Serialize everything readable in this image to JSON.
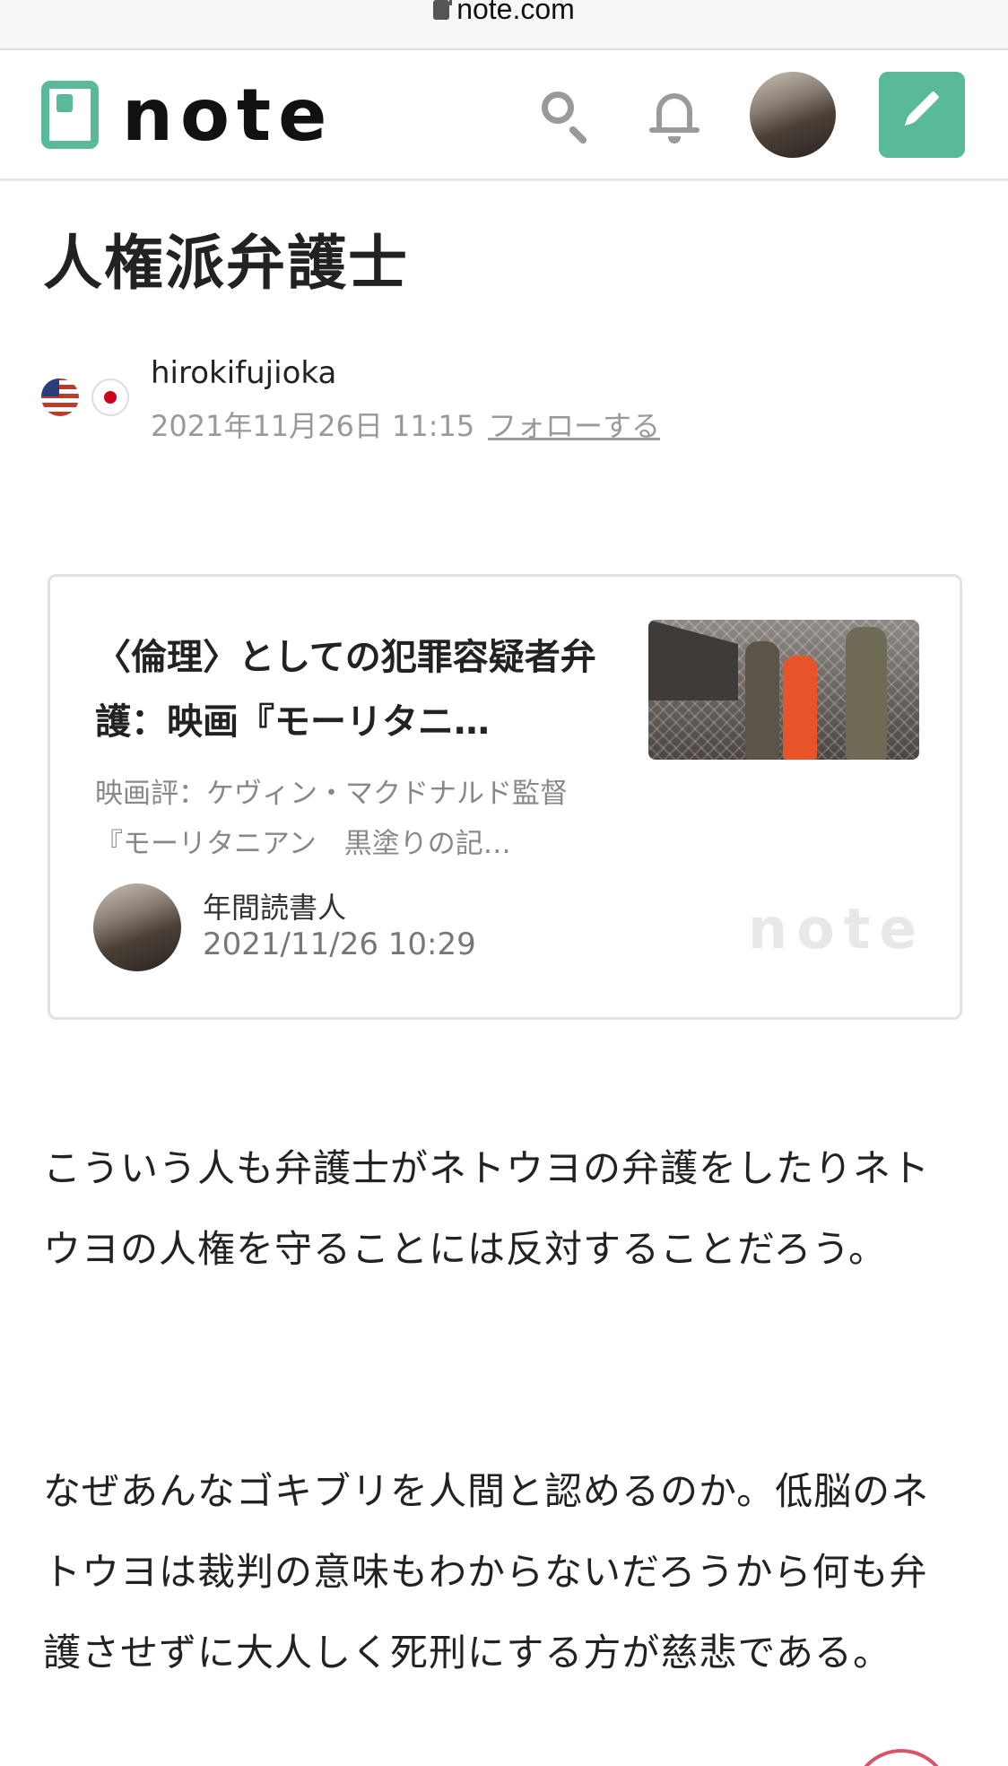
{
  "browser": {
    "url": "note.com"
  },
  "header": {
    "logo_text": "note",
    "search_icon": "search-icon",
    "notification_icon": "bell-icon",
    "post_icon": "pencil-icon",
    "accent_color": "#5ab89b"
  },
  "article": {
    "title": "人権派弁護士",
    "author": "hirokifujioka",
    "date": "2021年11月26日 11:15",
    "follow_label": "フォローする",
    "paragraphs": [
      "こういう人も弁護士がネトウヨの弁護をしたりネトウヨの人権を守ることには反対することだろう。",
      "なぜあんなゴキブリを人間と認めるのか。低脳のネトウヨは裁判の意味もわからないだろうから何も弁護させずに大人しく死刑にする方が慈悲である。"
    ]
  },
  "embed": {
    "title": "〈倫理〉としての犯罪容疑者弁護：映画『モーリタニ…",
    "description": "映画評：ケヴィン・マクドナルド監督『モーリタニアン　黒塗りの記…",
    "author": "年間読書人",
    "date": "2021/11/26 10:29",
    "brand": "note"
  }
}
